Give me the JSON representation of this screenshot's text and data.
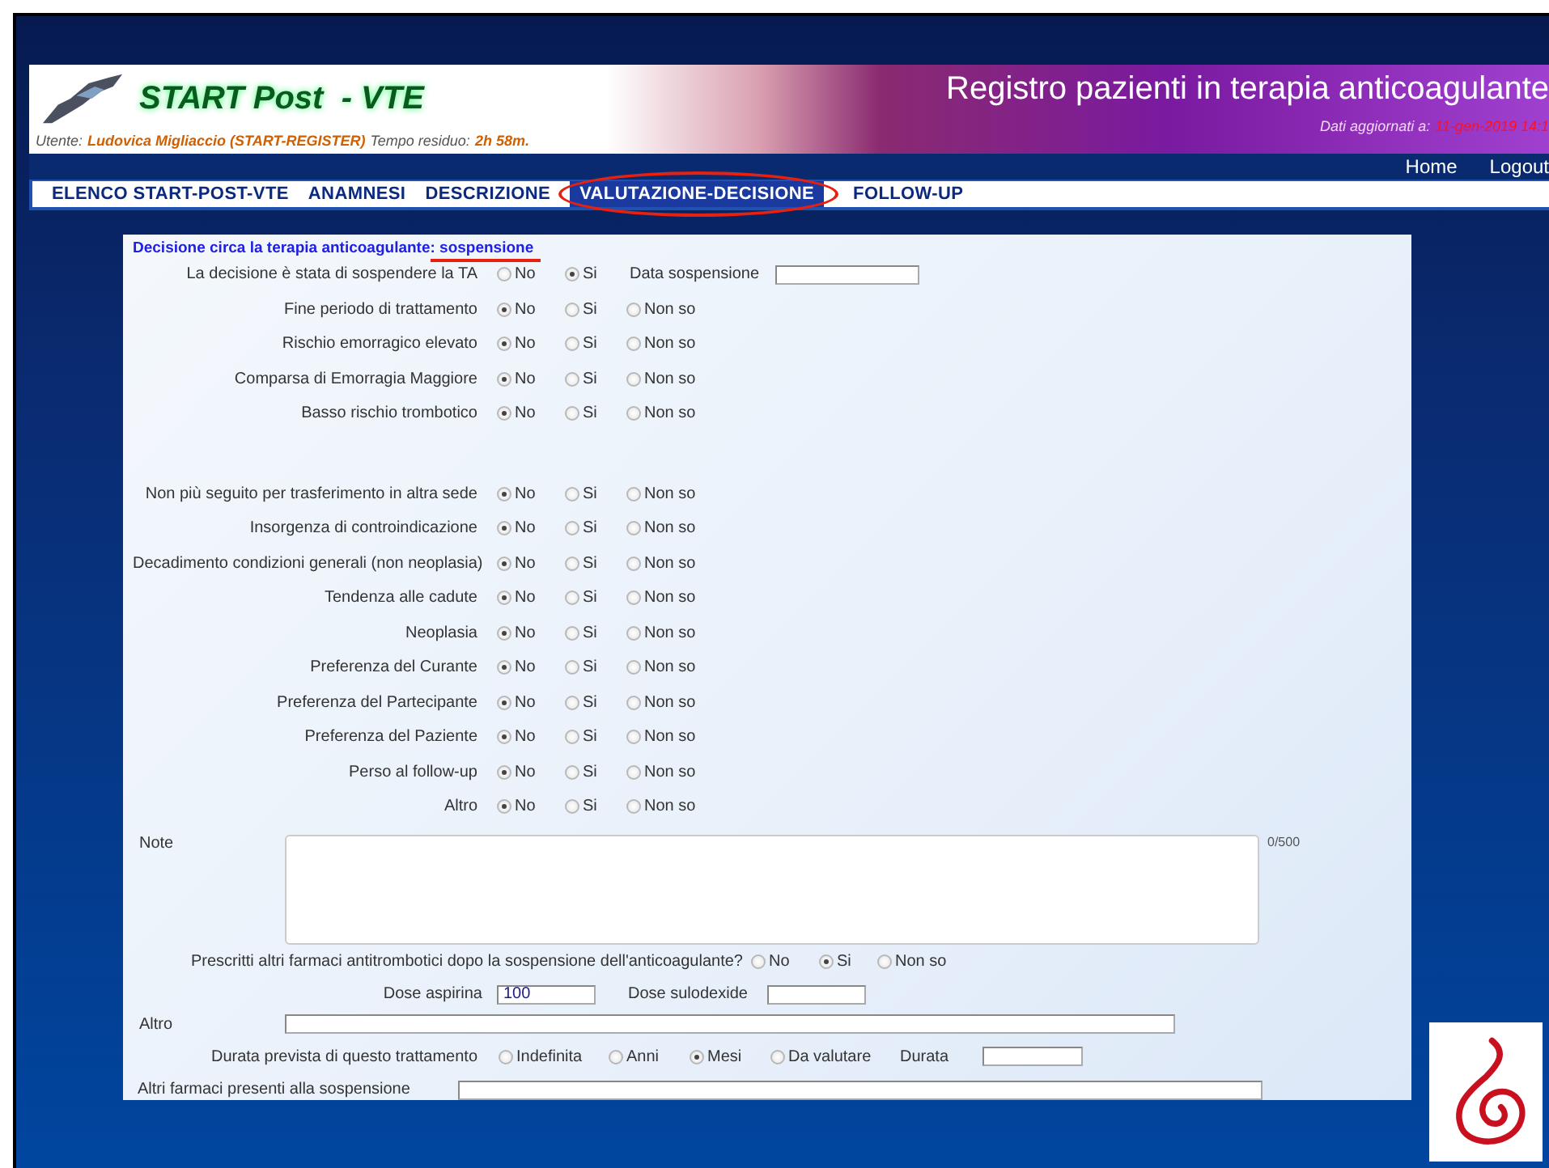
{
  "header": {
    "app_title": "START Post  - VTE",
    "user_label": "Utente:",
    "user_name": "Ludovica Migliaccio (START-REGISTER)",
    "time_label": "Tempo residuo:",
    "time_value": "2h 58m.",
    "site_title": "Registro pazienti in terapia anticoagulante",
    "updated_label": "Dati aggiornati a:",
    "updated_value": "11-gen-2019 14:1"
  },
  "nav_links": [
    "Home",
    "Logout"
  ],
  "tabs": [
    {
      "label": "ELENCO START-POST-VTE",
      "selected": false
    },
    {
      "label": "ANAMNESI",
      "selected": false
    },
    {
      "label": "DESCRIZIONE",
      "selected": false
    },
    {
      "label": "VALUTAZIONE-DECISIONE",
      "selected": true
    },
    {
      "label": "FOLLOW-UP",
      "selected": false
    }
  ],
  "form": {
    "heading": "Decisione circa la terapia anticoagulante: sospensione",
    "groups": [
      {
        "rows": [
          {
            "kind": "radio_date",
            "label": "La decisione è stata di sospendere la TA",
            "options": [
              {
                "label": "No",
                "selected": false
              },
              {
                "label": "Si",
                "selected": true
              }
            ],
            "date_label": "Data sospensione"
          },
          {
            "kind": "radio",
            "label": "Fine periodo di trattamento",
            "options": [
              {
                "label": "No",
                "selected": true
              },
              {
                "label": "Si",
                "selected": false
              },
              {
                "label": "Non so",
                "selected": false
              }
            ]
          },
          {
            "kind": "radio",
            "label": "Rischio emorragico elevato",
            "options": [
              {
                "label": "No",
                "selected": true
              },
              {
                "label": "Si",
                "selected": false
              },
              {
                "label": "Non so",
                "selected": false
              }
            ]
          },
          {
            "kind": "radio",
            "label": "Comparsa di Emorragia Maggiore",
            "options": [
              {
                "label": "No",
                "selected": true
              },
              {
                "label": "Si",
                "selected": false
              },
              {
                "label": "Non so",
                "selected": false
              }
            ]
          },
          {
            "kind": "radio",
            "label": "Basso rischio trombotico",
            "options": [
              {
                "label": "No",
                "selected": true
              },
              {
                "label": "Si",
                "selected": false
              },
              {
                "label": "Non so",
                "selected": false
              }
            ]
          }
        ]
      },
      {
        "rows": [
          {
            "kind": "radio",
            "label": "Non più seguito per trasferimento in altra sede",
            "options": [
              {
                "label": "No",
                "selected": true
              },
              {
                "label": "Si",
                "selected": false
              },
              {
                "label": "Non so",
                "selected": false
              }
            ]
          },
          {
            "kind": "radio",
            "label": "Insorgenza di controindicazione",
            "options": [
              {
                "label": "No",
                "selected": true
              },
              {
                "label": "Si",
                "selected": false
              },
              {
                "label": "Non so",
                "selected": false
              }
            ]
          },
          {
            "kind": "radio",
            "label": "Decadimento condizioni generali (non neoplasia)",
            "options": [
              {
                "label": "No",
                "selected": true
              },
              {
                "label": "Si",
                "selected": false
              },
              {
                "label": "Non so",
                "selected": false
              }
            ]
          },
          {
            "kind": "radio",
            "label": "Tendenza alle cadute",
            "options": [
              {
                "label": "No",
                "selected": true
              },
              {
                "label": "Si",
                "selected": false
              },
              {
                "label": "Non so",
                "selected": false
              }
            ]
          },
          {
            "kind": "radio",
            "label": "Neoplasia",
            "options": [
              {
                "label": "No",
                "selected": true
              },
              {
                "label": "Si",
                "selected": false
              },
              {
                "label": "Non so",
                "selected": false
              }
            ]
          },
          {
            "kind": "radio",
            "label": "Preferenza del Curante",
            "options": [
              {
                "label": "No",
                "selected": true
              },
              {
                "label": "Si",
                "selected": false
              },
              {
                "label": "Non so",
                "selected": false
              }
            ]
          },
          {
            "kind": "radio",
            "label": "Preferenza del Partecipante",
            "options": [
              {
                "label": "No",
                "selected": true
              },
              {
                "label": "Si",
                "selected": false
              },
              {
                "label": "Non so",
                "selected": false
              }
            ]
          },
          {
            "kind": "radio",
            "label": "Preferenza del Paziente",
            "options": [
              {
                "label": "No",
                "selected": true
              },
              {
                "label": "Si",
                "selected": false
              },
              {
                "label": "Non so",
                "selected": false
              }
            ]
          },
          {
            "kind": "radio",
            "label": "Perso al follow-up",
            "options": [
              {
                "label": "No",
                "selected": true
              },
              {
                "label": "Si",
                "selected": false
              },
              {
                "label": "Non so",
                "selected": false
              }
            ]
          },
          {
            "kind": "radio",
            "label": "Altro",
            "options": [
              {
                "label": "No",
                "selected": true
              },
              {
                "label": "Si",
                "selected": false
              },
              {
                "label": "Non so",
                "selected": false
              }
            ]
          }
        ]
      }
    ],
    "note": {
      "label": "Note",
      "counter": "0/500"
    },
    "antithrombotic": {
      "label": "Prescritti altri farmaci antitrombotici dopo la sospensione dell'anticoagulante?",
      "options": [
        {
          "label": "No",
          "selected": false
        },
        {
          "label": "Si",
          "selected": true
        },
        {
          "label": "Non so",
          "selected": false
        }
      ]
    },
    "doses": [
      {
        "label": "Dose aspirina",
        "value": "100"
      },
      {
        "label": "Dose sulodexide"
      }
    ],
    "other": {
      "label": "Altro"
    },
    "duration": {
      "label": "Durata prevista di questo trattamento",
      "options": [
        {
          "label": "Indefinita",
          "selected": false
        },
        {
          "label": "Anni",
          "selected": false
        },
        {
          "label": "Mesi",
          "selected": true
        },
        {
          "label": "Da valutare",
          "selected": false
        }
      ],
      "field_label": "Durata"
    },
    "other_drugs": {
      "label": "Altri farmaci presenti alla sospensione"
    }
  }
}
